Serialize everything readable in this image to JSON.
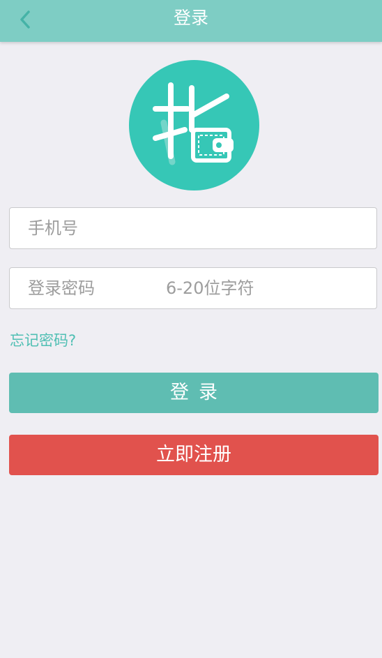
{
  "header": {
    "title": "登录",
    "back_icon": "chevron-left-icon"
  },
  "logo": {
    "icon": "app-logo-wallet",
    "color": "#36c7b6"
  },
  "form": {
    "phone_placeholder": "手机号",
    "password_label": "登录密码",
    "password_placeholder": "6-20位字符",
    "forgot_label": "忘记密码?"
  },
  "buttons": {
    "login_label": "登录",
    "register_label": "立即注册"
  },
  "colors": {
    "header_bg": "#7ecdc4",
    "login_bg": "#5fbdb2",
    "register_bg": "#e1524d",
    "link": "#4fbfb3",
    "page_bg": "#efeef3"
  }
}
